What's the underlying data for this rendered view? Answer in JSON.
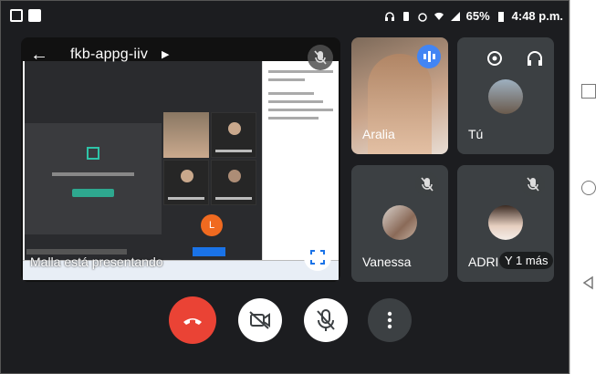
{
  "status_bar": {
    "battery": "65%",
    "time": "4:48 p.m."
  },
  "meeting": {
    "code": "fkb-appg-iiv",
    "presenting_label": "Malla está presentando"
  },
  "participants": [
    {
      "name": "Aralia"
    },
    {
      "name": "Tú"
    },
    {
      "name": "Vanessa"
    },
    {
      "name": "ADRI"
    }
  ],
  "overflow": {
    "label": "Y 1 más"
  },
  "shared_screen": {
    "orange_avatar_letter": "L"
  },
  "icons": {
    "back": "arrow-left-icon",
    "chevron": "chevron-right-icon",
    "mic_off": "mic-off-icon",
    "switch_camera": "switch-camera-icon",
    "audio_output": "headphones-icon",
    "fullscreen": "fullscreen-icon",
    "end_call": "end-call-icon",
    "camera_off": "camera-off-icon",
    "more": "more-vert-icon"
  },
  "colors": {
    "background": "#1c1d20",
    "tile": "#3c4043",
    "end_call": "#ea4335",
    "speaking": "#4285f4"
  }
}
